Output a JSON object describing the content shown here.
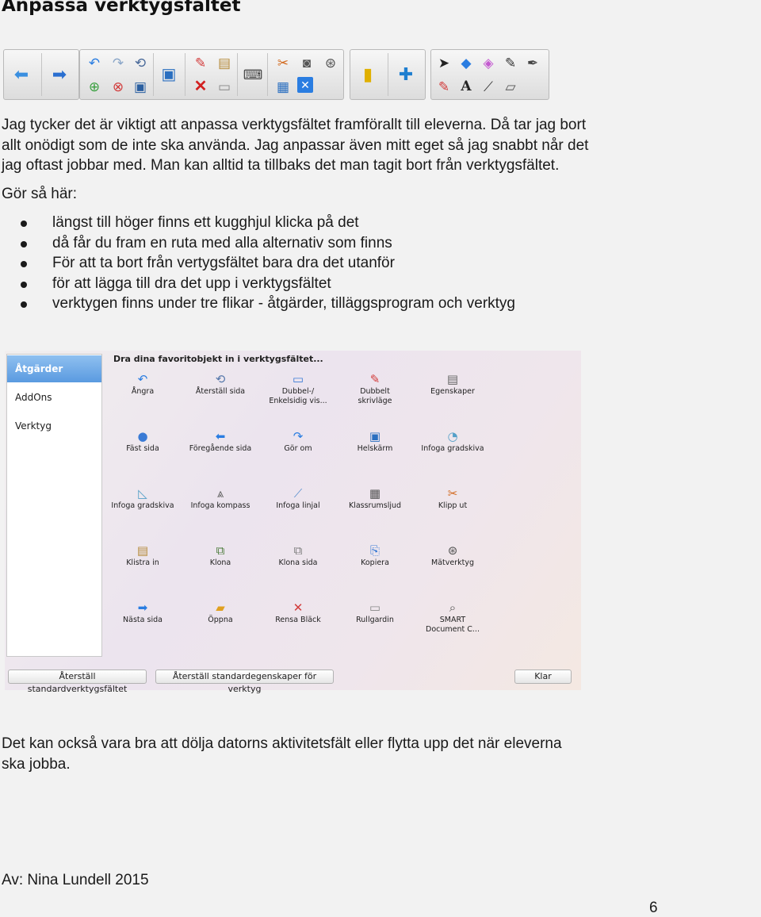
{
  "heading": "Anpassa verktygsfältet",
  "toolbar": {
    "groups": [
      {
        "name": "navigation",
        "icons": [
          "arrow-left-icon",
          "arrow-right-icon"
        ]
      },
      {
        "name": "page-tools",
        "icons": [
          "undo-icon",
          "redo-icon",
          "reset-page-icon",
          "add-page-icon",
          "delete-page-icon",
          "save-icon",
          "screen-icon",
          "pens-icon",
          "delete-icon",
          "paste-icon",
          "screen-shade-icon",
          "keyboard-icon",
          "cut-icon",
          "camera-icon",
          "table-icon",
          "close-table-icon",
          "measure-icon"
        ]
      },
      {
        "name": "addons",
        "icons": [
          "lesson-activity-icon",
          "puzzle-icon"
        ]
      },
      {
        "name": "tools",
        "icons": [
          "select-arrow-icon",
          "shapes-icon",
          "eraser-pink-icon",
          "pen-icon",
          "magic-pen-icon",
          "creative-pens-icon",
          "text-icon",
          "line-icon",
          "eraser-icon"
        ]
      }
    ]
  },
  "intro": {
    "text": "Jag tycker det är viktigt att anpassa verktygsfältet framförallt till eleverna. Då tar jag bort\nallt onödigt som de inte ska använda. Jag anpassar även mitt eget så jag snabbt når det\njag oftast jobbar med. Man kan alltid ta tillbaks det man tagit bort från verktygsfältet.",
    "howto": "Gör så här:"
  },
  "steps": [
    "längst till höger finns ett kugghjul klicka på det",
    "då får du fram en ruta med alla alternativ som finns",
    "För att ta bort från vertygsfältet bara dra det utanför",
    "för att lägga till dra det upp i verktygsfältet",
    "verktygen finns under tre flikar - åtgärder, tilläggsprogram och verktyg"
  ],
  "dialog": {
    "title": "Dra dina favoritobjekt in i verktygsfältet...",
    "sidebar": [
      "Åtgärder",
      "AddOns",
      "Verktyg"
    ],
    "items": [
      {
        "label": "Ångra",
        "icon": "undo-icon",
        "glyph": "↶",
        "color": "#2a7de1"
      },
      {
        "label": "Återställ sida",
        "icon": "reset-page-icon",
        "glyph": "⟲",
        "color": "#5577aa"
      },
      {
        "label": "Dubbel-/\nEnkelsidig vis...",
        "icon": "dual-page-icon",
        "glyph": "▭",
        "color": "#3a7bd5"
      },
      {
        "label": "Dubbelt\nskrivläge",
        "icon": "dual-pens-icon",
        "glyph": "✎",
        "color": "#d23b3b"
      },
      {
        "label": "Egenskaper",
        "icon": "properties-icon",
        "glyph": "▤",
        "color": "#666"
      },
      {
        "label": "Fäst sida",
        "icon": "pin-page-icon",
        "glyph": "●",
        "color": "#3a7bd5"
      },
      {
        "label": "Föregående sida",
        "icon": "previous-page-icon",
        "glyph": "⬅",
        "color": "#2a7de1"
      },
      {
        "label": "Gör om",
        "icon": "redo-icon",
        "glyph": "↷",
        "color": "#2a7de1"
      },
      {
        "label": "Helskärm",
        "icon": "fullscreen-icon",
        "glyph": "▣",
        "color": "#2a6fc0"
      },
      {
        "label": "Infoga gradskiva",
        "icon": "protractor-icon",
        "glyph": "◔",
        "color": "#55a0c8"
      },
      {
        "label": "Infoga gradskiva",
        "icon": "set-square-icon",
        "glyph": "◺",
        "color": "#55a0c8"
      },
      {
        "label": "Infoga kompass",
        "icon": "compass-icon",
        "glyph": "⩓",
        "color": "#666"
      },
      {
        "label": "Infoga linjal",
        "icon": "ruler-icon",
        "glyph": "⟋",
        "color": "#5a8fcf"
      },
      {
        "label": "Klassrumsljud",
        "icon": "classroom-audio-icon",
        "glyph": "▦",
        "color": "#555"
      },
      {
        "label": "Klipp ut",
        "icon": "cut-icon",
        "glyph": "✂",
        "color": "#d2691e"
      },
      {
        "label": "Klistra in",
        "icon": "paste-icon",
        "glyph": "▤",
        "color": "#b58a3a"
      },
      {
        "label": "Klona",
        "icon": "clone-icon",
        "glyph": "⧉",
        "color": "#4a7a3a"
      },
      {
        "label": "Klona sida",
        "icon": "clone-page-icon",
        "glyph": "⧉",
        "color": "#7a7a7a"
      },
      {
        "label": "Kopiera",
        "icon": "copy-icon",
        "glyph": "⎘",
        "color": "#3a7bd5"
      },
      {
        "label": "Mätverktyg",
        "icon": "measurement-tools-icon",
        "glyph": "⊛",
        "color": "#555"
      },
      {
        "label": "Nästa sida",
        "icon": "next-page-icon",
        "glyph": "➡",
        "color": "#2a7de1"
      },
      {
        "label": "Öppna",
        "icon": "open-folder-icon",
        "glyph": "▰",
        "color": "#e0a020"
      },
      {
        "label": "Rensa Bläck",
        "icon": "clear-ink-icon",
        "glyph": "✕",
        "color": "#d23b3b"
      },
      {
        "label": "Rullgardin",
        "icon": "screen-shade-icon",
        "glyph": "▭",
        "color": "#888"
      },
      {
        "label": "SMART\nDocument C...",
        "icon": "document-camera-icon",
        "glyph": "⌕",
        "color": "#555"
      }
    ],
    "buttons": {
      "reset_toolbar": "Återställ standardverktygsfältet",
      "reset_properties": "Återställ standardegenskaper för verktyg",
      "done": "Klar"
    }
  },
  "outro": "Det kan också vara bra att dölja datorns aktivitetsfält eller flytta upp det när eleverna\nska jobba.",
  "author": "Av: Nina Lundell 2015",
  "page_number": "6",
  "colors": {
    "toolbar_blue": "#2a7de1",
    "red": "#d23b3b",
    "selection_blue": "#5a9ae0"
  }
}
